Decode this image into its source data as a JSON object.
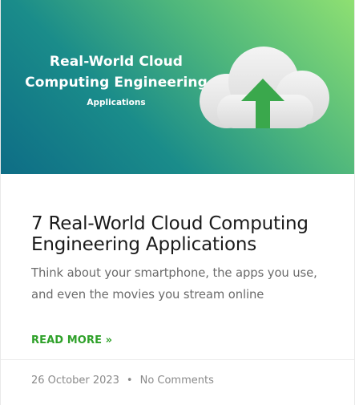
{
  "hero": {
    "title": "Real-World Cloud Computing Engineering",
    "subtitle": "Applications",
    "icon": "cloud-upload-icon"
  },
  "post": {
    "title": "7 Real-World Cloud Computing Engineering Applications",
    "excerpt": "Think about your smartphone, the apps you use, and even the movies you stream online",
    "read_more": "READ MORE »"
  },
  "meta": {
    "date": "26 October 2023",
    "separator": "•",
    "comments": "No Comments"
  },
  "colors": {
    "accent": "#2fa12a",
    "title_text": "#1a1a1a",
    "muted_text": "#8a8a8a"
  }
}
